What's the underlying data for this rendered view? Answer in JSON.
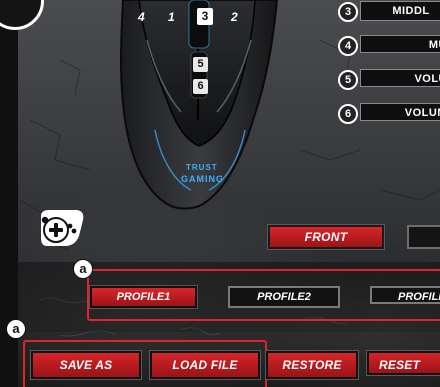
{
  "mouse": {
    "button_numbers": [
      "4",
      "1",
      "3",
      "2",
      "5",
      "6"
    ],
    "brand_lines": [
      "TRUST",
      "GAMING"
    ],
    "accent_color": "#3ab0ff"
  },
  "button_assignments": [
    {
      "number": "3",
      "label": "MIDDL"
    },
    {
      "number": "4",
      "label": "MU"
    },
    {
      "number": "5",
      "label": "VOLU"
    },
    {
      "number": "6",
      "label": "VOLUM"
    }
  ],
  "views": {
    "front": "FRONT",
    "back": ""
  },
  "annotations": {
    "profiles_marker": "a",
    "file_marker": "a",
    "color": "#e0242b"
  },
  "profiles": [
    {
      "label": "PROFILE1",
      "active": true
    },
    {
      "label": "PROFILE2",
      "active": false
    },
    {
      "label": "PROFILI",
      "active": false
    }
  ],
  "actions": {
    "save_as": "SAVE AS",
    "load_file": "LOAD FILE",
    "restore": "RESTORE",
    "reset": "RESET"
  },
  "colors": {
    "button_red": "#c41e22",
    "background": "#2e3033",
    "icon_white": "#ffffff"
  },
  "icons": [
    "gamepad-icon"
  ]
}
